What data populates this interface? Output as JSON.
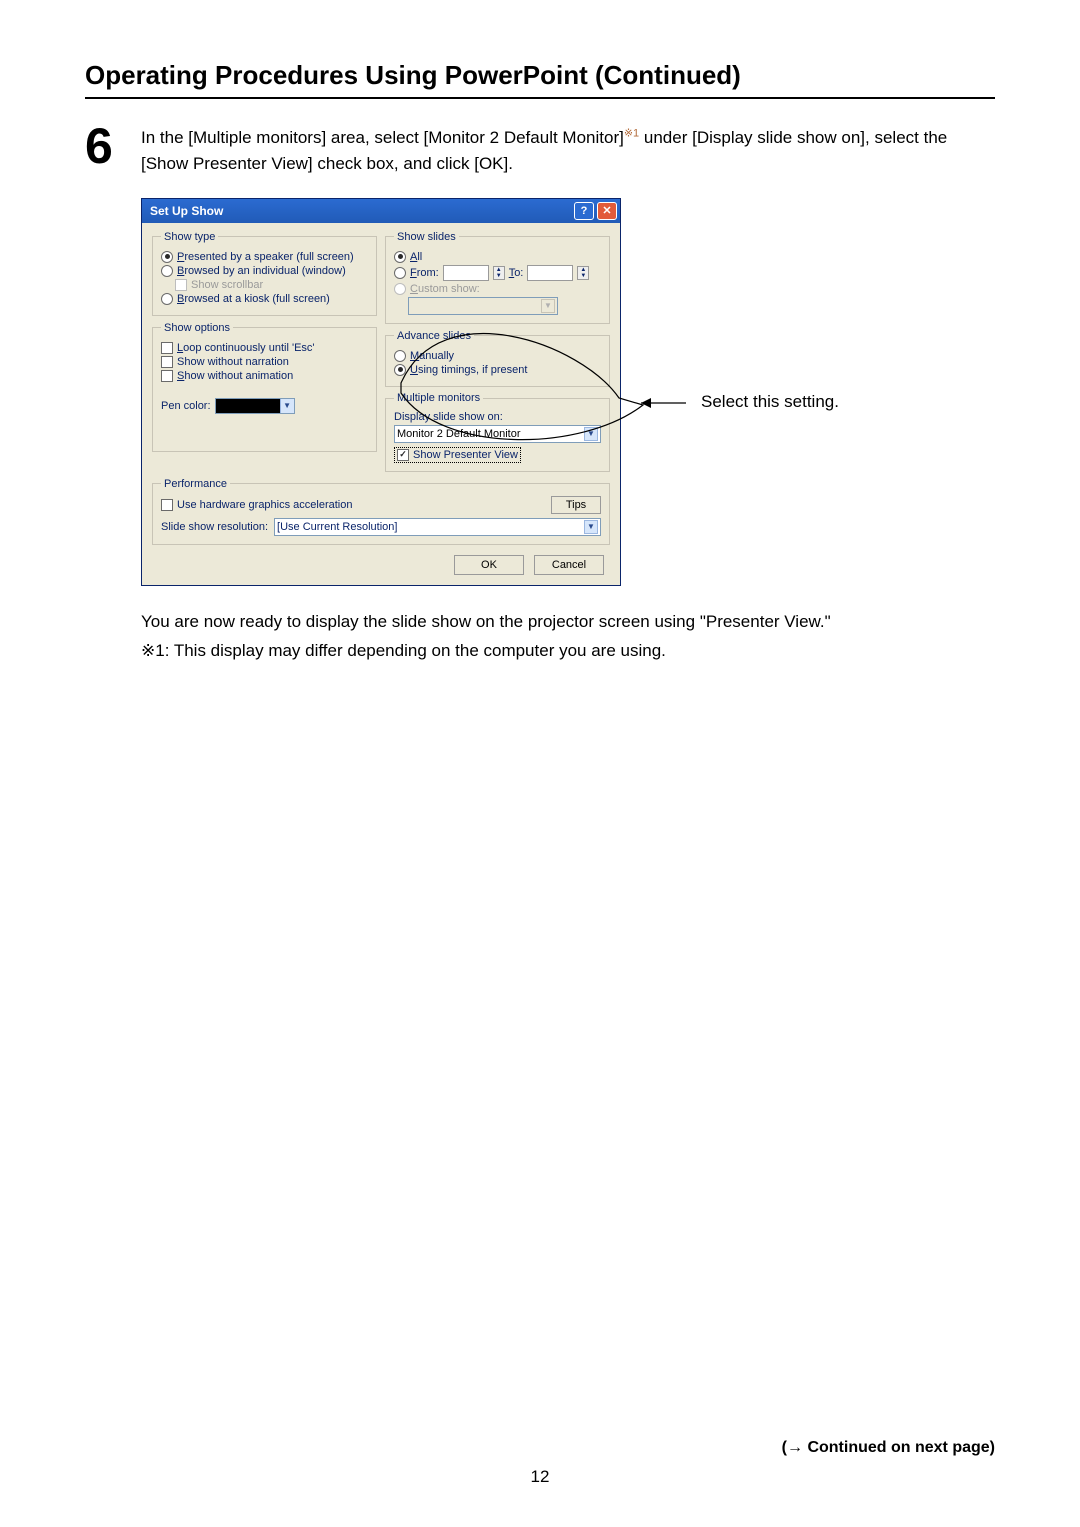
{
  "page": {
    "title": "Operating Procedures Using PowerPoint (Continued)",
    "step_number": "6",
    "step_text_before_fn": "In the [Multiple monitors] area, select [Monitor 2 Default Monitor]",
    "step_fn": "※1",
    "step_text_after_fn": " under [Display slide show on], select the [Show Presenter View] check box, and click [OK].",
    "callout": "Select this setting.",
    "post1": "You are now ready to display the slide show on the projector screen using \"Presenter View.\"",
    "post2": "※1: This display may differ depending on the computer you are using.",
    "page_number": "12",
    "continued": "(→ Continued on next page)"
  },
  "dialog": {
    "title": "Set Up Show",
    "show_type": {
      "legend": "Show type",
      "opt1": "Presented by a speaker (full screen)",
      "opt2": "Browsed by an individual (window)",
      "scrollbar": "Show scrollbar",
      "opt3": "Browsed at a kiosk (full screen)"
    },
    "show_slides": {
      "legend": "Show slides",
      "all": "All",
      "from": "From:",
      "to": "To:",
      "custom": "Custom show:"
    },
    "show_options": {
      "legend": "Show options",
      "loop": "Loop continuously until 'Esc'",
      "no_narration": "Show without narration",
      "no_animation": "Show without animation",
      "pen_color": "Pen color:"
    },
    "advance": {
      "legend": "Advance slides",
      "manually": "Manually",
      "timings": "Using timings, if present"
    },
    "multiple_monitors": {
      "legend": "Multiple monitors",
      "display_on": "Display slide show on:",
      "monitor": "Monitor 2 Default Monitor",
      "presenter": "Show Presenter View"
    },
    "performance": {
      "legend": "Performance",
      "hw_accel": "Use hardware graphics acceleration",
      "tips": "Tips",
      "resolution_label": "Slide show resolution:",
      "resolution_value": "[Use Current Resolution]"
    },
    "buttons": {
      "ok": "OK",
      "cancel": "Cancel"
    }
  }
}
